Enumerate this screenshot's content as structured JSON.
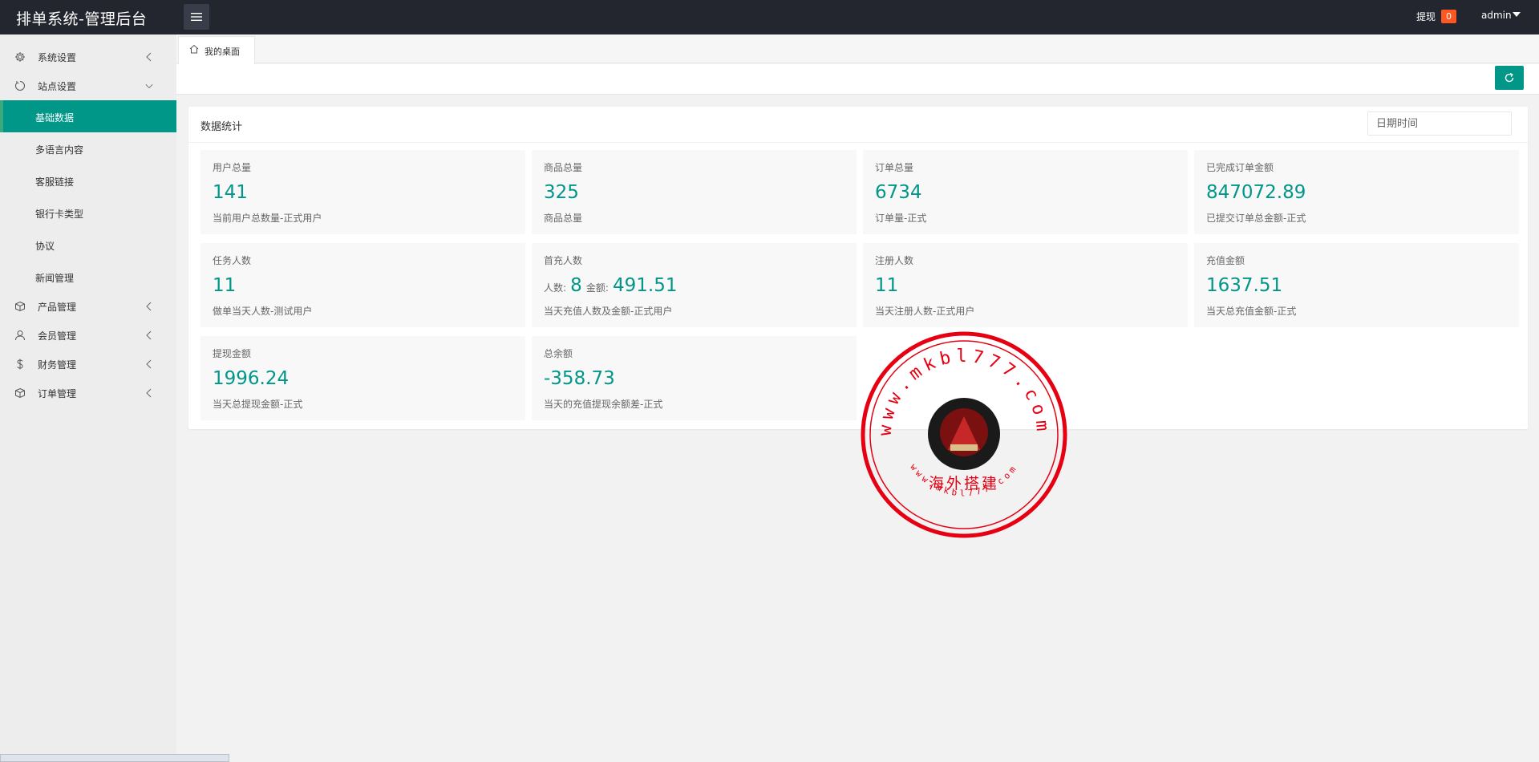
{
  "header": {
    "brand": "排单系统-管理后台",
    "withdraw_label": "提现",
    "withdraw_count": "0",
    "user_name": "admin"
  },
  "sidebar": {
    "items": [
      {
        "label": "系统设置",
        "icon": "gear-icon",
        "arrow": "left"
      },
      {
        "label": "站点设置",
        "icon": "site-icon",
        "arrow": "down"
      },
      {
        "label": "产品管理",
        "icon": "cube-icon",
        "arrow": "left"
      },
      {
        "label": "会员管理",
        "icon": "user-icon",
        "arrow": "left"
      },
      {
        "label": "财务管理",
        "icon": "dollar-icon",
        "arrow": "left"
      },
      {
        "label": "订单管理",
        "icon": "cube-icon",
        "arrow": "left"
      }
    ],
    "sub_items": [
      {
        "label": "基础数据",
        "active": true
      },
      {
        "label": "多语言内容",
        "active": false
      },
      {
        "label": "客服链接",
        "active": false
      },
      {
        "label": "银行卡类型",
        "active": false
      },
      {
        "label": "协议",
        "active": false
      },
      {
        "label": "新闻管理",
        "active": false
      }
    ]
  },
  "tabs": [
    {
      "label": "我的桌面",
      "icon": "home-icon"
    }
  ],
  "main": {
    "title": "数据统计",
    "date_placeholder": "日期时间",
    "stats": [
      {
        "title": "用户总量",
        "value": "141",
        "desc": "当前用户总数量-正式用户"
      },
      {
        "title": "商品总量",
        "value": "325",
        "desc": "商品总量"
      },
      {
        "title": "订单总量",
        "value": "6734",
        "desc": "订单量-正式"
      },
      {
        "title": "已完成订单金额",
        "value": "847072.89",
        "desc": "已提交订单总金额-正式"
      },
      {
        "title": "任务人数",
        "value": "11",
        "desc": "做单当天人数-测试用户"
      },
      {
        "title": "首充人数",
        "count_label": "人数:",
        "count": "8",
        "amount_label": "金额:",
        "amount": "491.51",
        "desc": "当天充值人数及金额-正式用户"
      },
      {
        "title": "注册人数",
        "value": "11",
        "desc": "当天注册人数-正式用户"
      },
      {
        "title": "充值金额",
        "value": "1637.51",
        "desc": "当天总充值金额-正式"
      },
      {
        "title": "提现金额",
        "value": "1996.24",
        "desc": "当天总提现金额-正式"
      },
      {
        "title": "总余额",
        "value": "-358.73",
        "desc": "当天的充值提现余额差-正式"
      }
    ]
  },
  "stamp": {
    "url_top": "www.mkbl777.com",
    "center_text": "海外搭建",
    "url_bottom": "www.mkbl777.com"
  },
  "colors": {
    "header_bg": "#23262e",
    "accent": "#009688",
    "badge": "#ff5722",
    "stamp_red": "#e60012"
  }
}
